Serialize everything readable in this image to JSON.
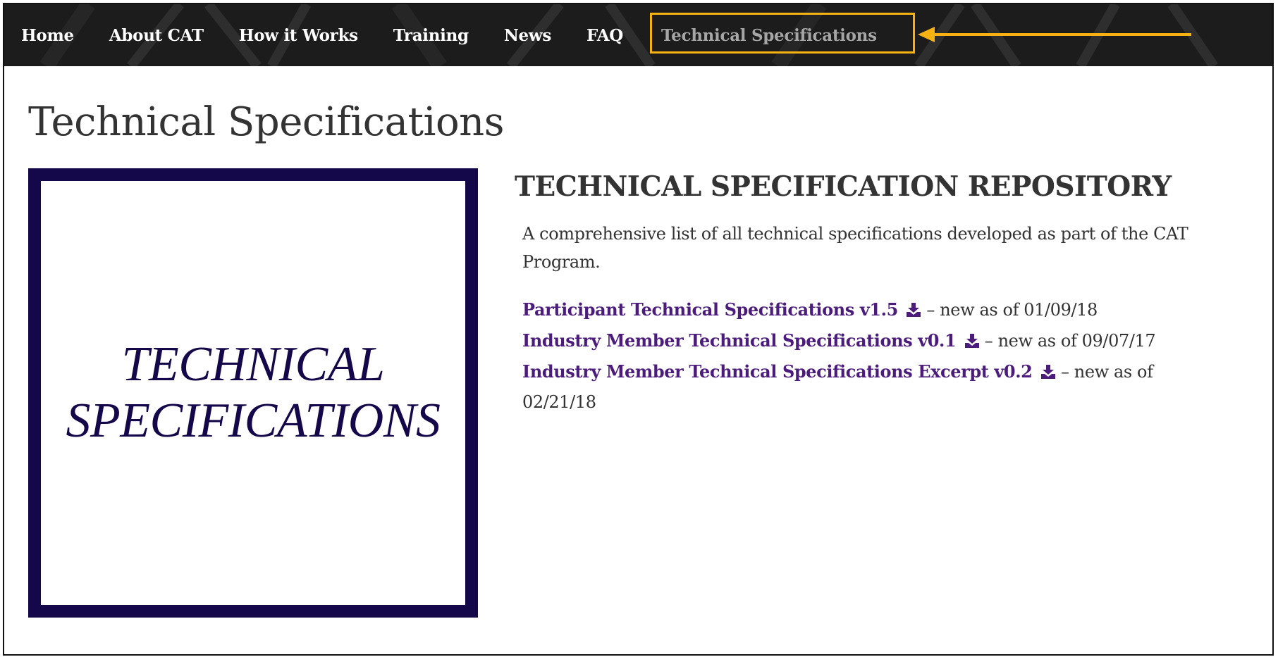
{
  "nav": {
    "items": [
      {
        "label": "Home"
      },
      {
        "label": "About CAT"
      },
      {
        "label": "How it Works"
      },
      {
        "label": "Training"
      },
      {
        "label": "News"
      },
      {
        "label": "FAQ"
      },
      {
        "label": "Technical Specifications",
        "active": true
      }
    ]
  },
  "page": {
    "title": "Technical Specifications"
  },
  "image": {
    "line1": "TECHNICAL",
    "line2": "SPECIFICATIONS"
  },
  "repository": {
    "heading": "TECHNICAL SPECIFICATION REPOSITORY",
    "description": "A comprehensive list of all technical specifications developed as part of the CAT Program.",
    "documents": [
      {
        "title": "Participant Technical Specifications v1.5",
        "note": " – new as of 01/09/18",
        "icon": "download-icon"
      },
      {
        "title": "Industry Member Technical Specifications v0.1",
        "note": " – new as of 09/07/17",
        "icon": "download-icon"
      },
      {
        "title": "Industry Member Technical Specifications Excerpt v0.2",
        "note": " – new as of 02/21/18",
        "icon": "download-icon"
      }
    ]
  },
  "annotation": {
    "highlight_color": "#f5b212",
    "icon": "left-arrow-icon"
  },
  "colors": {
    "navbar_bg": "#1c1c1c",
    "nav_active": "#a6a6a6",
    "link": "#4b1c7c",
    "image_frame": "#14074a",
    "text": "#333333"
  }
}
